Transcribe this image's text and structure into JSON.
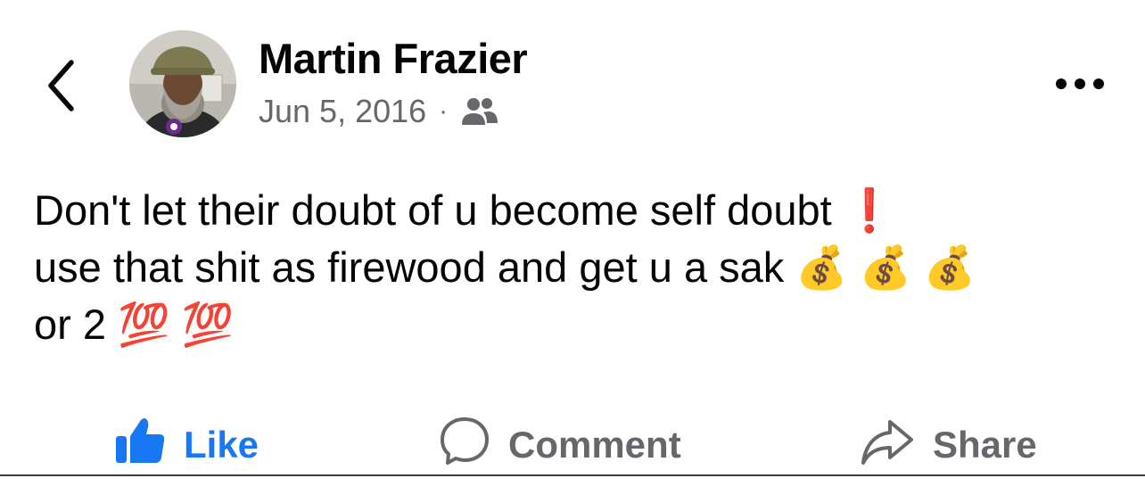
{
  "post": {
    "author": "Martin Frazier",
    "date": "Jun 5, 2016",
    "separator": "·",
    "audience_icon": "friends-icon",
    "text": "Don't let their doubt of u become self doubt ❗\nuse that shit as firewood and get u a sak 💰 💰 💰\nor 2 💯 💯"
  },
  "actions": {
    "like": "Like",
    "comment": "Comment",
    "share": "Share"
  },
  "colors": {
    "like_blue": "#1877f2",
    "secondary_text": "#65676b",
    "primary_text": "#050505"
  }
}
